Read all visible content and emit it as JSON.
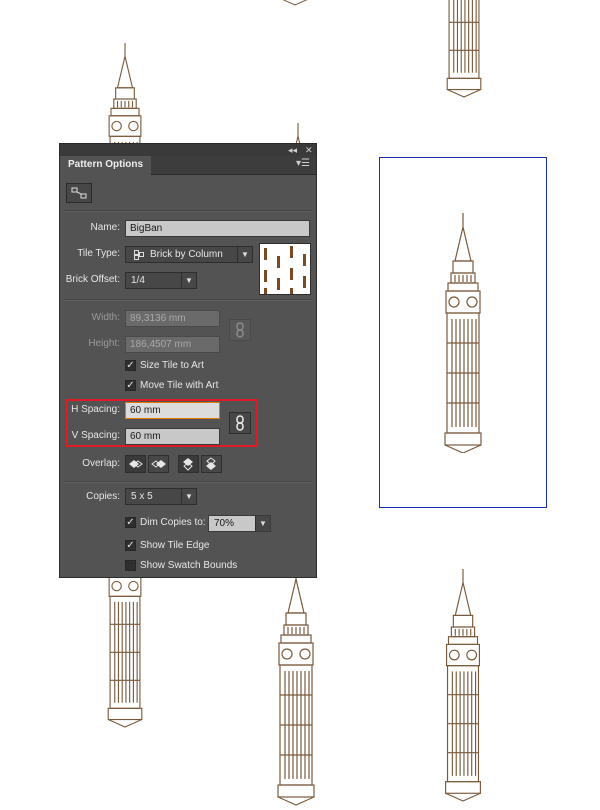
{
  "panel": {
    "title": "Pattern Options",
    "collapse_icon": "double-chevron-left",
    "close_icon": "close-x",
    "menu_icon": "flyout-menu",
    "tile_tool_icon": "pattern-tile-tool",
    "name_label": "Name:",
    "name_value": "BigBan",
    "tile_type_label": "Tile Type:",
    "tile_type_value": "Brick by Column",
    "brick_offset_label": "Brick Offset:",
    "brick_offset_value": "1/4",
    "width_label": "Width:",
    "width_value": "89,3136 mm",
    "height_label": "Height:",
    "height_value": "186,4507 mm",
    "size_tile_to_art_label": "Size Tile to Art",
    "size_tile_to_art_checked": true,
    "move_tile_with_art_label": "Move Tile with Art",
    "move_tile_with_art_checked": true,
    "h_spacing_label": "H Spacing:",
    "h_spacing_value": "60 mm",
    "v_spacing_label": "V Spacing:",
    "v_spacing_value": "60 mm",
    "overlap_label": "Overlap:",
    "copies_label": "Copies:",
    "copies_value": "5 x 5",
    "dim_copies_label": "Dim Copies to:",
    "dim_copies_checked": true,
    "dim_copies_value": "70%",
    "show_tile_edge_label": "Show Tile Edge",
    "show_tile_edge_checked": true,
    "show_swatch_bounds_label": "Show Swatch Bounds",
    "show_swatch_bounds_checked": false
  },
  "colors": {
    "panel_bg": "#535353",
    "tile_edge": "#1a2fb0",
    "highlight": "#e01b24",
    "art": "#7a5a3c"
  }
}
